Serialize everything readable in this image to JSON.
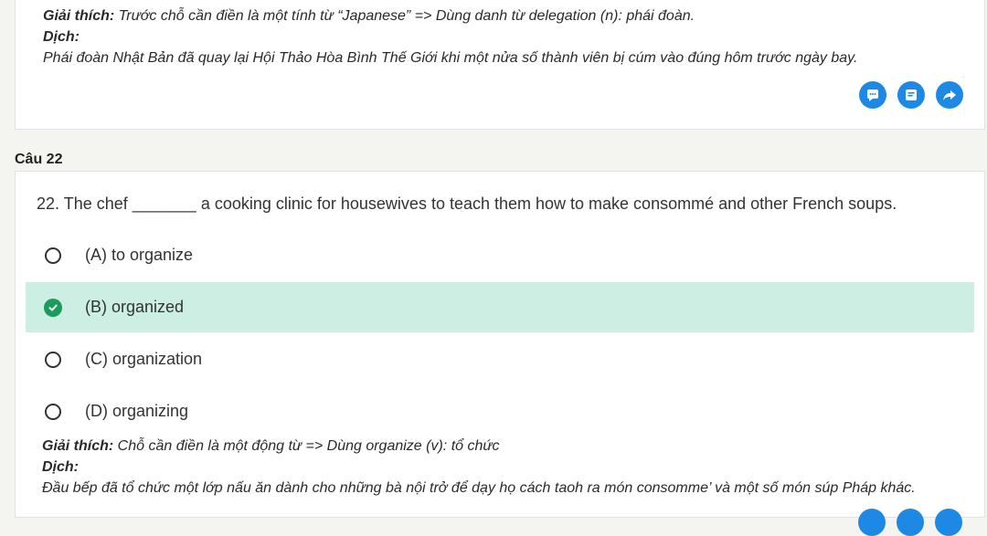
{
  "prev": {
    "expl_label": "Giải thích:",
    "expl_text": " Trước chỗ cần điền là một tính từ “Japanese” => Dùng danh từ delegation (n): phái đoàn.",
    "trans_label": "Dịch:",
    "trans_text": "Phái đoàn Nhật Bản đã quay lại Hội Thảo Hòa Bình Thế Giới khi một nửa số thành viên bị cúm vào đúng hôm trước ngày bay.",
    "actions": [
      "comment-icon",
      "note-icon",
      "share-icon"
    ]
  },
  "question": {
    "label": "Câu 22",
    "text": "22. The chef _______ a cooking clinic for housewives to teach them how to make consommé and other French soups.",
    "options": [
      {
        "text": "(A) to organize",
        "selected": false
      },
      {
        "text": "(B) organized",
        "selected": true
      },
      {
        "text": "(C) organization",
        "selected": false
      },
      {
        "text": "(D) organizing",
        "selected": false
      }
    ],
    "expl_label": "Giải thích:",
    "expl_text": " Chỗ cần điền là một động từ => Dùng organize (v): tổ chức",
    "trans_label": "Dịch:",
    "trans_text": "Đầu bếp đã tổ chức một lớp nấu ăn dành cho những bà nội trở để dạy họ cách taoh ra món consomme’ và một số món súp Pháp khác."
  },
  "colors": {
    "accent": "#1e88e5",
    "selected_bg": "#cdeee2",
    "check": "#1a9c5b"
  }
}
